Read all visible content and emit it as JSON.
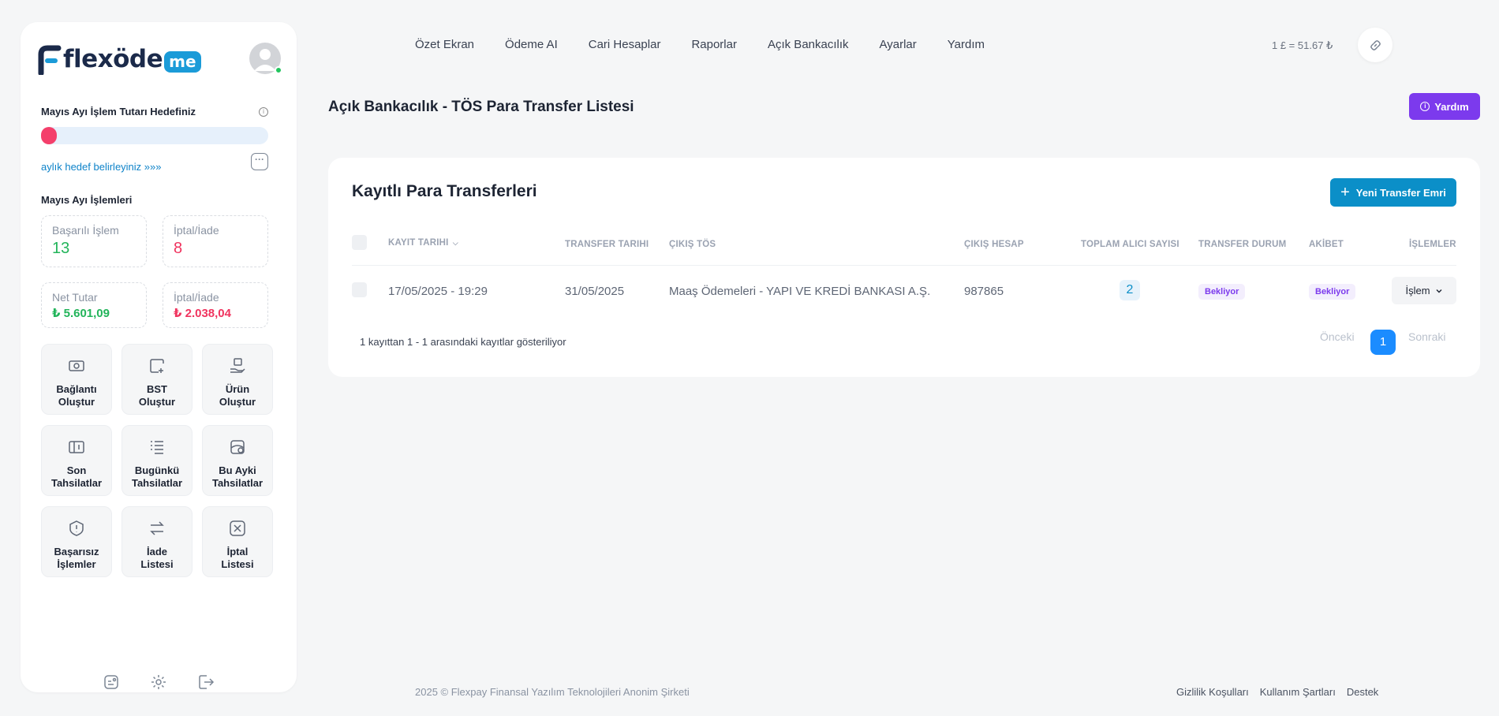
{
  "sidebar": {
    "logo": {
      "main": "flexöde",
      "suffix": "me"
    },
    "goal": {
      "title": "Mayıs Ayı İşlem Tutarı Hedefiniz",
      "progress": 0.07,
      "link": "aylık hedef belirleyiniz »»»"
    },
    "month": {
      "title": "Mayıs Ayı İşlemleri",
      "success_label": "Başarılı İşlem",
      "success_value": "13",
      "cancel_label": "İptal/İade",
      "cancel_value": "8",
      "net_label": "Net Tutar",
      "net_value": "₺ 5.601,09",
      "cancel_amount_label": "İptal/İade",
      "cancel_amount_value": "₺ 2.038,04"
    },
    "tiles": [
      {
        "line1": "Bağlantı",
        "line2": "Oluştur",
        "icon": "money-icon"
      },
      {
        "line1": "BST",
        "line2": "Oluştur",
        "icon": "wallet-add-icon"
      },
      {
        "line1": "Ürün",
        "line2": "Oluştur",
        "icon": "hand-box-icon"
      },
      {
        "line1": "Son",
        "line2": "Tahsilatlar",
        "icon": "card-icon"
      },
      {
        "line1": "Bugünkü",
        "line2": "Tahsilatlar",
        "icon": "list-icon"
      },
      {
        "line1": "Bu Ayki",
        "line2": "Tahsilatlar",
        "icon": "calendar-icon"
      },
      {
        "line1": "Başarısız",
        "line2": "İşlemler",
        "icon": "alert-icon"
      },
      {
        "line1": "İade",
        "line2": "Listesi",
        "icon": "exchange-icon"
      },
      {
        "line1": "İptal",
        "line2": "Listesi",
        "icon": "cancel-icon"
      }
    ]
  },
  "nav": {
    "items": [
      "Özet Ekran",
      "Ödeme AI",
      "Cari Hesaplar",
      "Raporlar",
      "Açık Bankacılık",
      "Ayarlar",
      "Yardım"
    ],
    "rate": "1 £ = 51.67 ₺"
  },
  "page": {
    "title": "Açık Bankacılık - TÖS Para Transfer Listesi",
    "help_label": "Yardım"
  },
  "card": {
    "title": "Kayıtlı Para Transferleri",
    "new_button": "Yeni Transfer Emri",
    "columns": [
      "KAYIT TARIHI",
      "TRANSFER TARIHI",
      "ÇIKIŞ TÖS",
      "ÇIKIŞ HESAP",
      "TOPLAM ALICI SAYISI",
      "TRANSFER DURUM",
      "AKİBET",
      "İŞLEMLER"
    ],
    "rows": [
      {
        "created": "17/05/2025 - 19:29",
        "transfer_date": "31/05/2025",
        "source": "Maaş Ödemeleri - YAPI VE KREDİ BANKASI A.Ş.",
        "account": "987865",
        "recipients": "2",
        "status": "Bekliyor",
        "result": "Bekliyor",
        "action": "İşlem"
      }
    ],
    "info": "1 kayıttan 1 - 1 arasındaki kayıtlar gösteriliyor",
    "pager": {
      "prev": "Önceki",
      "current": "1",
      "next": "Sonraki"
    }
  },
  "footer": {
    "copyright": "2025 © Flexpay Finansal Yazılım Teknolojileri Anonim Şirketi",
    "links": [
      "Gizlilik Koşulları",
      "Kullanım Şartları",
      "Destek"
    ]
  },
  "colors": {
    "accent": "#0b8fc8",
    "help": "#7c3aed",
    "success": "#22b45a",
    "danger": "#f0345f"
  }
}
